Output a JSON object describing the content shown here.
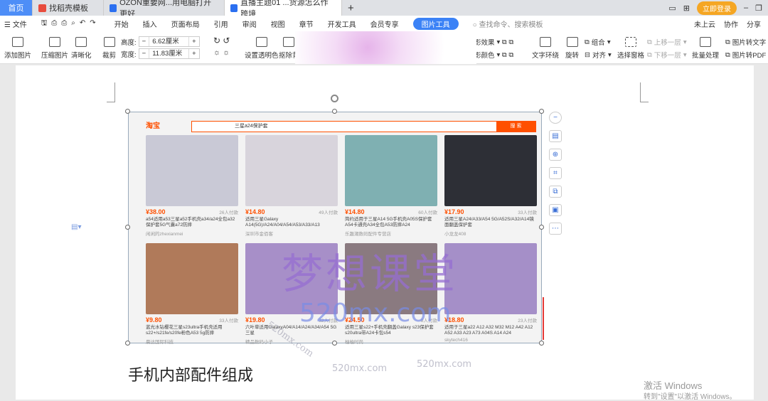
{
  "tabs": [
    {
      "label": "首页"
    },
    {
      "label": "找稻壳模板"
    },
    {
      "label": "OZON重要网...用电脑打开更好"
    },
    {
      "label": "直播主题01 ...货源怎么作跨境"
    }
  ],
  "window": {
    "login": "立即登录"
  },
  "menu": {
    "file": "文件",
    "items": [
      "开始",
      "插入",
      "页面布局",
      "引用",
      "审阅",
      "视图",
      "章节",
      "开发工具",
      "会员专享"
    ],
    "picture_tools": "图片工具",
    "search": "查找命令、搜索模板",
    "cloud": "未上云",
    "collab": "协作",
    "share": "分享"
  },
  "ribbon": {
    "add_picture": "添加图片",
    "compress": "压缩图片",
    "sharpen": "清晰化",
    "crop": "裁剪",
    "height_label": "高度:",
    "height_value": "6.62厘米",
    "width_label": "宽度:",
    "width_value": "11.83厘米",
    "set_transparent": "设置透明色",
    "remove_bg": "抠除背",
    "effects": "影效果",
    "color": "影颜色",
    "text_wrap": "文字环绕",
    "rotate": "旋转",
    "group": "组合",
    "align": "对齐",
    "selection_pane": "选择窗格",
    "bring_forward": "上移一层",
    "send_backward": "下移一层",
    "batch": "批量处理",
    "to_text": "图片转文字",
    "to_pdf": "图片转PDF"
  },
  "image": {
    "logo": "淘宝",
    "search_query": "三星a24保护套",
    "search_btn": "搜 索",
    "products": [
      {
        "price": "¥38.00",
        "sold": "26人付款",
        "title": "a54适用a53三星a52手机壳a34/a24全包a32保护套5G气囊a72防摔",
        "shop": "闲闲的zhexianmei"
      },
      {
        "price": "¥14.80",
        "sold": "49人付款",
        "title": "适用三星Galaxy A14(5G)/A24/A04/A54/A53/A33/A13",
        "shop": "深圳市金佰客"
      },
      {
        "price": "¥14.80",
        "sold": "60人付款",
        "title": "简约适用于三星A14 5G手机壳A05S保护套A54卡通壳A34全包A53防摔A24",
        "shop": "乐趣潮数码配件专营店"
      },
      {
        "price": "¥17.90",
        "sold": "33人付款",
        "title": "适用三星A24/A33/A54 5G/A52S/A32/A14镜面翻盖保护套",
        "shop": "小龙龙408"
      },
      {
        "price": "¥9.80",
        "sold": "33人付款",
        "title": "蓝光水钻樱花三星s23ultra手机壳适用s22+/s21fe/s20fe粉色A53 5g防摔",
        "shop": "晨达国际科技"
      },
      {
        "price": "¥19.80",
        "sold": "32人付款",
        "title": "六叶草适用GalaxyA04/A14/A24/A34/A54 5G三星",
        "shop": "精品数码小子"
      },
      {
        "price": "¥24.50",
        "sold": "8人付款",
        "title": "适用三星s22+手机壳翻盖Galaxy s23保护套s20ultra带A24卡包s54",
        "shop": "柚柚时尚"
      },
      {
        "price": "¥18.80",
        "sold": "23人付款",
        "title": "适用于三星a22 A12 A32 M32 M12 A42 A12 A52 A33 A23 A73 A04S A14 A24",
        "shop": "skytech416"
      }
    ]
  },
  "watermark": {
    "main": "梦想课堂",
    "site": "520mx.com"
  },
  "document": {
    "caption": "手机内部配件组成"
  },
  "system": {
    "activate": "激活 Windows",
    "activate_hint": "转到\"设置\"以激活 Windows。"
  }
}
